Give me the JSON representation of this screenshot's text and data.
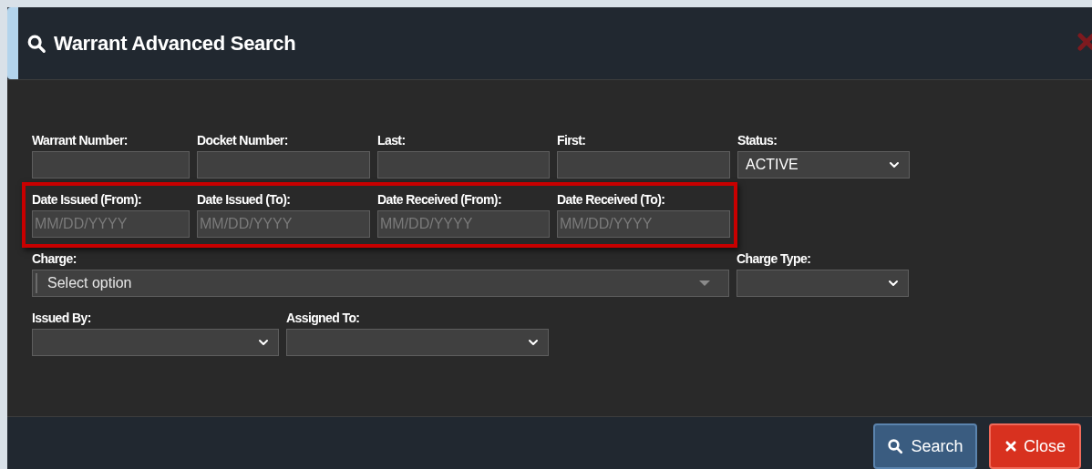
{
  "dialog": {
    "title": "Warrant Advanced Search"
  },
  "rows": [
    [
      {
        "kind": "text",
        "label": "Warrant Number:"
      },
      {
        "kind": "text",
        "label": "Docket Number:"
      },
      {
        "kind": "text",
        "label": "Last:"
      },
      {
        "kind": "text",
        "label": "First:"
      },
      {
        "kind": "select",
        "label": "Status:",
        "value": "ACTIVE"
      }
    ],
    [
      {
        "kind": "date",
        "label": "Date Issued (From):",
        "placeholder": "MM/DD/YYYY"
      },
      {
        "kind": "date",
        "label": "Date Issued (To):",
        "placeholder": "MM/DD/YYYY"
      },
      {
        "kind": "date",
        "label": "Date Received (From):",
        "placeholder": "MM/DD/YYYY"
      },
      {
        "kind": "date",
        "label": "Date Received (To):",
        "placeholder": "MM/DD/YYYY"
      }
    ],
    [
      {
        "kind": "combobox",
        "label": "Charge:",
        "placeholder": "Select option"
      },
      {
        "kind": "select",
        "label": "Charge Type:"
      }
    ],
    [
      {
        "kind": "select",
        "label": "Issued By:"
      },
      {
        "kind": "select",
        "label": "Assigned To:"
      }
    ]
  ],
  "buttons": [
    {
      "kind": "search",
      "label": "Search"
    },
    {
      "kind": "close",
      "label": "Close"
    }
  ]
}
